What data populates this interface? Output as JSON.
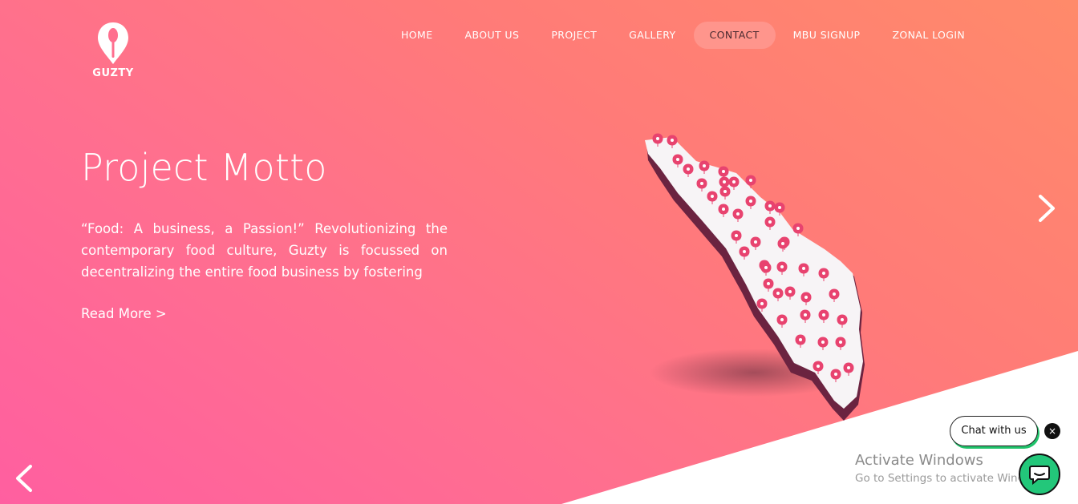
{
  "brand": {
    "name": "GUZTY",
    "logo_icon": "spoon-pin-logo-icon"
  },
  "nav": {
    "items": [
      {
        "label": "HOME",
        "active": false
      },
      {
        "label": "ABOUT US",
        "active": false
      },
      {
        "label": "PROJECT",
        "active": false
      },
      {
        "label": "GALLERY",
        "active": false
      },
      {
        "label": "CONTACT",
        "active": true
      },
      {
        "label": "MBU SIGNUP",
        "active": false
      },
      {
        "label": "ZONAL LOGIN",
        "active": false
      }
    ]
  },
  "hero": {
    "title": "Project Motto",
    "description": "“Food: A business, a Passion!” Revolutionizing the contemporary food culture, Guzty is focussed on decentralizing the entire food business by fostering",
    "read_more": "Read More  >"
  },
  "slider": {
    "next_icon": "chevron-right-icon",
    "prev_icon": "chevron-left-icon"
  },
  "chat": {
    "bubble_label": "Chat with us",
    "close_glyph": "×",
    "launcher_icon": "chat-bubble-icon"
  },
  "os_watermark": {
    "title": "Activate Windows",
    "subtitle": "Go to Settings to activate Windows."
  },
  "colors": {
    "gradient_start": "#ff5fa0",
    "gradient_end": "#ff8a6a",
    "active_nav_bg": "#ff958c",
    "chat_green": "#23c77a",
    "pin_color": "#e8436f"
  }
}
